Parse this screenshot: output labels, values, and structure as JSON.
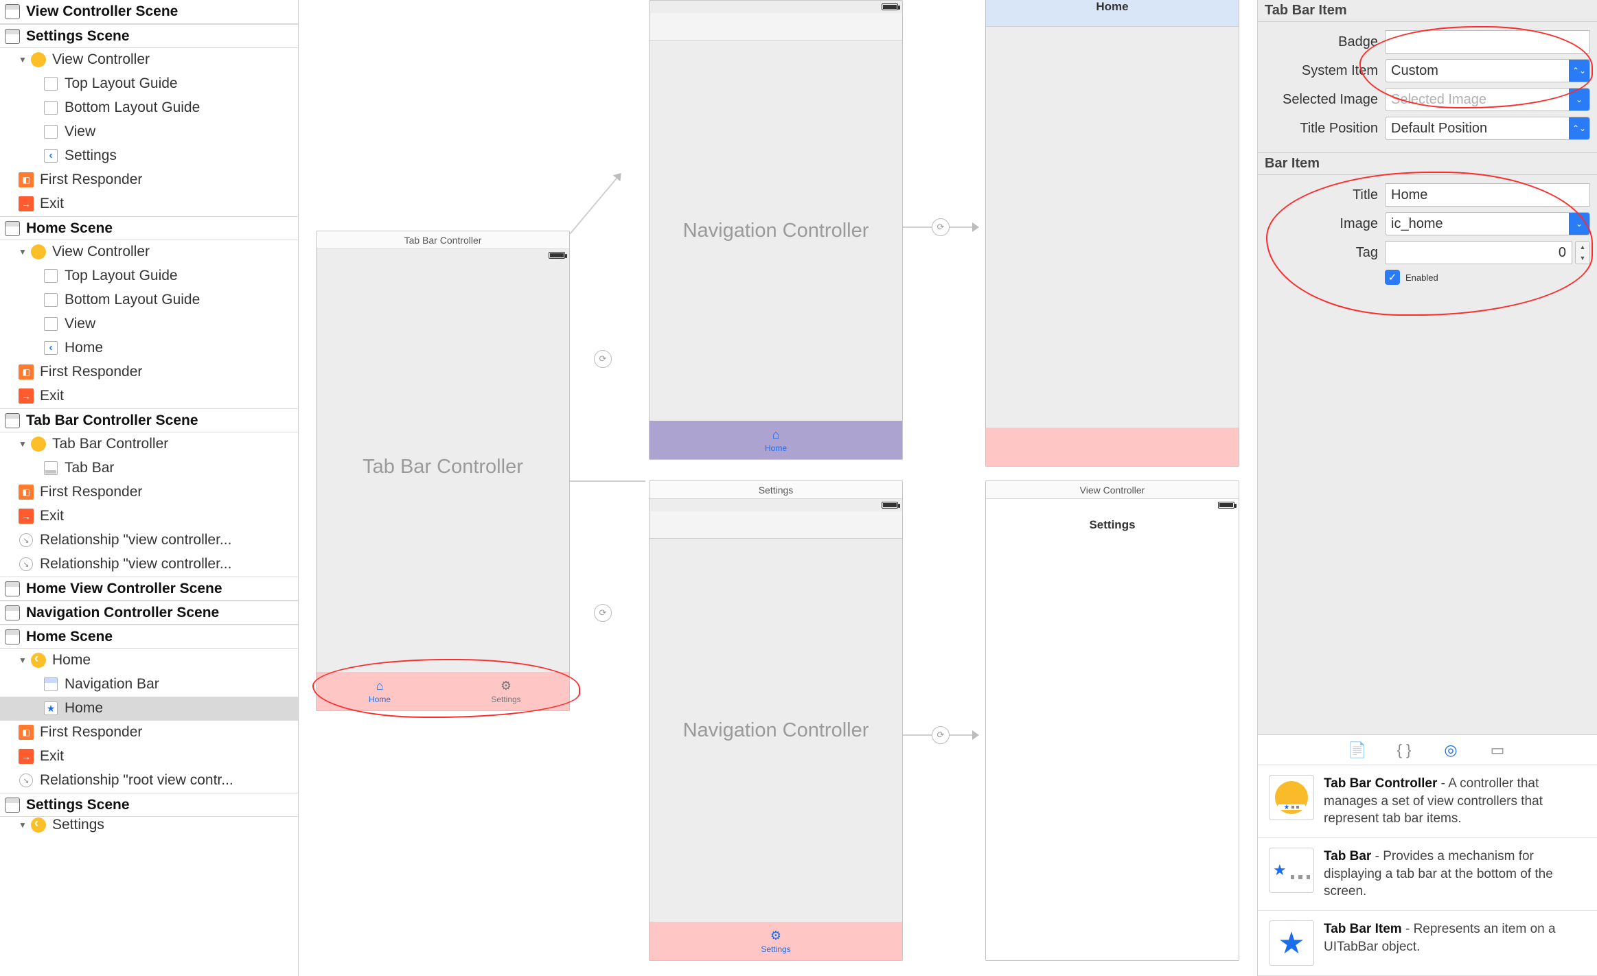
{
  "outline": {
    "scenes": [
      {
        "header": "View Controller Scene",
        "items": []
      },
      {
        "header": "Settings Scene",
        "items": [
          {
            "indent": 1,
            "icon": "circle-yellow",
            "label": "View Controller",
            "disclosure": "down"
          },
          {
            "indent": 2,
            "icon": "doc",
            "label": "Top Layout Guide"
          },
          {
            "indent": 2,
            "icon": "doc",
            "label": "Bottom Layout Guide"
          },
          {
            "indent": 2,
            "icon": "doc",
            "label": "View"
          },
          {
            "indent": 2,
            "icon": "back",
            "label": "Settings"
          },
          {
            "indent": 1,
            "icon": "cube",
            "label": "First Responder"
          },
          {
            "indent": 1,
            "icon": "exit",
            "label": "Exit"
          }
        ]
      },
      {
        "header": "Home Scene",
        "items": [
          {
            "indent": 1,
            "icon": "circle-yellow",
            "label": "View Controller",
            "disclosure": "down"
          },
          {
            "indent": 2,
            "icon": "doc",
            "label": "Top Layout Guide"
          },
          {
            "indent": 2,
            "icon": "doc",
            "label": "Bottom Layout Guide"
          },
          {
            "indent": 2,
            "icon": "doc",
            "label": "View"
          },
          {
            "indent": 2,
            "icon": "back",
            "label": "Home"
          },
          {
            "indent": 1,
            "icon": "cube",
            "label": "First Responder"
          },
          {
            "indent": 1,
            "icon": "exit",
            "label": "Exit"
          }
        ]
      },
      {
        "header": "Tab Bar Controller Scene",
        "items": [
          {
            "indent": 1,
            "icon": "circle-yellow",
            "label": "Tab Bar Controller",
            "disclosure": "down"
          },
          {
            "indent": 2,
            "icon": "tabbar",
            "label": "Tab Bar"
          },
          {
            "indent": 1,
            "icon": "cube",
            "label": "First Responder"
          },
          {
            "indent": 1,
            "icon": "exit",
            "label": "Exit"
          },
          {
            "indent": 1,
            "icon": "segue",
            "label": "Relationship \"view controller..."
          },
          {
            "indent": 1,
            "icon": "segue",
            "label": "Relationship \"view controller..."
          }
        ]
      },
      {
        "header": "Home View Controller Scene",
        "items": []
      },
      {
        "header": "Navigation Controller Scene",
        "items": []
      },
      {
        "header": "Home Scene",
        "items": [
          {
            "indent": 1,
            "icon": "circle-yellow-nav",
            "label": "Home",
            "disclosure": "down"
          },
          {
            "indent": 2,
            "icon": "navbar",
            "label": "Navigation Bar"
          },
          {
            "indent": 2,
            "icon": "star",
            "label": "Home",
            "selected": true
          },
          {
            "indent": 1,
            "icon": "cube",
            "label": "First Responder"
          },
          {
            "indent": 1,
            "icon": "exit",
            "label": "Exit"
          },
          {
            "indent": 1,
            "icon": "segue",
            "label": "Relationship \"root view contr..."
          }
        ]
      },
      {
        "header": "Settings Scene",
        "items": [
          {
            "indent": 1,
            "icon": "circle-yellow-nav",
            "label": "Settings",
            "disclosure": "down",
            "cutoff": true
          }
        ]
      }
    ]
  },
  "canvas": {
    "tabbarController": {
      "title": "Tab Bar Controller",
      "placeholder": "Tab Bar Controller",
      "tabs": [
        {
          "icon": "home",
          "label": "Home",
          "active": true
        },
        {
          "icon": "gear",
          "label": "Settings",
          "active": false
        }
      ]
    },
    "navHome": {
      "placeholder": "Navigation Controller",
      "bottomLabel": "Home"
    },
    "navSettings": {
      "title": "Settings",
      "placeholder": "Navigation Controller",
      "bottomLabel": "Settings"
    },
    "homeVC": {
      "navTitle": "Home"
    },
    "settingsVC": {
      "title": "View Controller",
      "navTitle": "Settings"
    }
  },
  "inspector": {
    "tabBarItem": {
      "section": "Tab Bar Item",
      "badge_label": "Badge",
      "badge_value": "",
      "systemItem_label": "System Item",
      "systemItem_value": "Custom",
      "selectedImage_label": "Selected Image",
      "selectedImage_placeholder": "Selected Image",
      "titlePosition_label": "Title Position",
      "titlePosition_value": "Default Position"
    },
    "barItem": {
      "section": "Bar Item",
      "title_label": "Title",
      "title_value": "Home",
      "image_label": "Image",
      "image_value": "ic_home",
      "tag_label": "Tag",
      "tag_value": "0",
      "enabled_label": "Enabled",
      "enabled_checked": true
    }
  },
  "library": {
    "items": [
      {
        "title": "Tab Bar Controller",
        "desc": " - A controller that manages a set of view controllers that represent tab bar items."
      },
      {
        "title": "Tab Bar",
        "desc": " - Provides a mechanism for displaying a tab bar at the bottom of the screen."
      },
      {
        "title": "Tab Bar Item",
        "desc": " - Represents an item on a UITabBar object."
      }
    ]
  }
}
